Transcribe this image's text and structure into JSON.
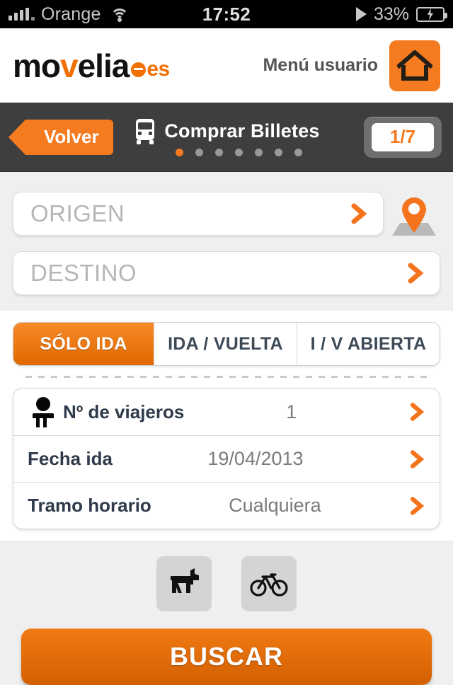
{
  "status_bar": {
    "carrier": "Orange",
    "time": "17:52",
    "battery_percent": "33%",
    "wifi_icon": "wifi-icon",
    "signal_icon": "signal-bars-icon",
    "play_icon": "play-icon",
    "battery_icon": "battery-charging-icon"
  },
  "header": {
    "logo_part1": "mo",
    "logo_v": "v",
    "logo_part2": "elia",
    "logo_tld": "es",
    "menu_user_label": "Menú usuario",
    "home_icon": "home-icon"
  },
  "navbar": {
    "back_label": "Volver",
    "title": "Comprar Billetes",
    "bus_icon": "bus-icon",
    "step_badge": "1/7",
    "steps_total": 7,
    "steps_active_index": 0
  },
  "search_form": {
    "origin_placeholder": "ORIGEN",
    "destination_placeholder": "DESTINO",
    "origin_value": "",
    "destination_value": "",
    "map_pin_icon": "map-pin-icon",
    "chevron_icon": "chevron-right-icon"
  },
  "trip_type": {
    "options": [
      {
        "label": "SÓLO IDA",
        "active": true
      },
      {
        "label": "IDA / VUELTA",
        "active": false
      },
      {
        "label": "I / V ABIERTA",
        "active": false
      }
    ]
  },
  "details": {
    "rows": [
      {
        "label": "Nº de viajeros",
        "value": "1",
        "icon": "passenger-icon"
      },
      {
        "label": "Fecha ida",
        "value": "19/04/2013",
        "icon": ""
      },
      {
        "label": "Tramo horario",
        "value": "Cualquiera",
        "icon": ""
      }
    ]
  },
  "extras": {
    "pet_icon": "dog-icon",
    "bike_icon": "bicycle-icon"
  },
  "actions": {
    "search_label": "BUSCAR"
  },
  "colors": {
    "accent_orange": "#f47b20",
    "accent_orange_dark": "#d35f00",
    "nav_gray": "#3e3e3e",
    "page_bg": "#efefef",
    "label_navy": "#2f3b4a",
    "value_gray": "#7b7b7b"
  }
}
